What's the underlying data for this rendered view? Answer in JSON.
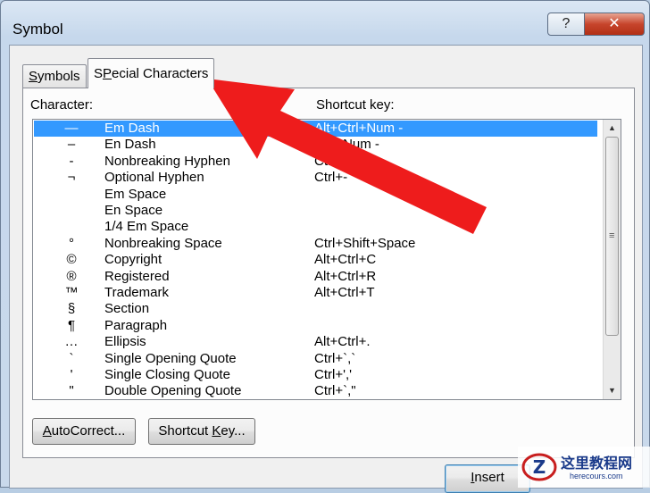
{
  "window": {
    "title": "Symbol",
    "help_label": "?",
    "close_label": "✕"
  },
  "tabs": [
    {
      "label": "Symbols",
      "accesskey": "S",
      "rest": "ymbols",
      "active": false
    },
    {
      "label": "Special Characters",
      "accesskey": "P",
      "pre": "S",
      "rest": "ecial Characters",
      "active": true
    }
  ],
  "columns": {
    "character": "Character:",
    "shortcut": "Shortcut key:"
  },
  "rows": [
    {
      "glyph": "—",
      "name": "Em Dash",
      "key": "Alt+Ctrl+Num -",
      "selected": true
    },
    {
      "glyph": "–",
      "name": "En Dash",
      "key": "Ctrl+Num -"
    },
    {
      "glyph": "‑",
      "name": "Nonbreaking Hyphen",
      "key": "Ctrl+Shift+_"
    },
    {
      "glyph": "¬",
      "name": "Optional Hyphen",
      "key": "Ctrl+-"
    },
    {
      "glyph": "",
      "name": "Em Space",
      "key": ""
    },
    {
      "glyph": "",
      "name": "En Space",
      "key": ""
    },
    {
      "glyph": "",
      "name": "1/4 Em Space",
      "key": ""
    },
    {
      "glyph": "°",
      "name": "Nonbreaking Space",
      "key": "Ctrl+Shift+Space"
    },
    {
      "glyph": "©",
      "name": "Copyright",
      "key": "Alt+Ctrl+C"
    },
    {
      "glyph": "®",
      "name": "Registered",
      "key": "Alt+Ctrl+R"
    },
    {
      "glyph": "™",
      "name": "Trademark",
      "key": "Alt+Ctrl+T"
    },
    {
      "glyph": "§",
      "name": "Section",
      "key": ""
    },
    {
      "glyph": "¶",
      "name": "Paragraph",
      "key": ""
    },
    {
      "glyph": "…",
      "name": "Ellipsis",
      "key": "Alt+Ctrl+."
    },
    {
      "glyph": "`",
      "name": "Single Opening Quote",
      "key": "Ctrl+`,`"
    },
    {
      "glyph": "'",
      "name": "Single Closing Quote",
      "key": "Ctrl+','"
    },
    {
      "glyph": "\"",
      "name": "Double Opening Quote",
      "key": "Ctrl+`,\""
    }
  ],
  "buttons": {
    "autocorrect": {
      "pre": "",
      "ul": "A",
      "rest": "utoCorrect..."
    },
    "shortcut_key": {
      "pre": "Shortcut ",
      "ul": "K",
      "rest": "ey..."
    },
    "insert": {
      "pre": "",
      "ul": "I",
      "rest": "nsert"
    }
  },
  "annotation": {
    "arrow_color": "#ee1c1c"
  },
  "watermark": {
    "text": "这里教程网",
    "url": "herecours.com"
  }
}
